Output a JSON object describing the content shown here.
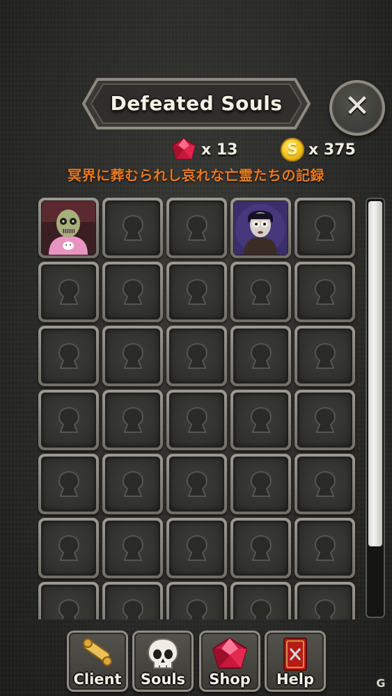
{
  "header": {
    "title": "Defeated Souls",
    "close_icon": "close-icon"
  },
  "currency": {
    "gems": {
      "icon": "ruby-gem-icon",
      "label": "x 13",
      "color": "#d8204a"
    },
    "coins": {
      "icon": "gold-coin-icon",
      "symbol": "S",
      "label": "x 375",
      "color": "#f2c21c"
    }
  },
  "subtitle": "冥界に葬むられし哀れな亡霊たちの記録",
  "grid": {
    "columns": 5,
    "slots": [
      {
        "state": "unlocked",
        "icon": "zombie-portrait-icon"
      },
      {
        "state": "locked"
      },
      {
        "state": "locked"
      },
      {
        "state": "unlocked",
        "icon": "ghost-boy-portrait-icon"
      },
      {
        "state": "locked"
      },
      {
        "state": "locked"
      },
      {
        "state": "locked"
      },
      {
        "state": "locked"
      },
      {
        "state": "locked"
      },
      {
        "state": "locked"
      },
      {
        "state": "locked"
      },
      {
        "state": "locked"
      },
      {
        "state": "locked"
      },
      {
        "state": "locked"
      },
      {
        "state": "locked"
      },
      {
        "state": "locked"
      },
      {
        "state": "locked"
      },
      {
        "state": "locked"
      },
      {
        "state": "locked"
      },
      {
        "state": "locked"
      },
      {
        "state": "locked"
      },
      {
        "state": "locked"
      },
      {
        "state": "locked"
      },
      {
        "state": "locked"
      },
      {
        "state": "locked"
      },
      {
        "state": "locked"
      },
      {
        "state": "locked"
      },
      {
        "state": "locked"
      },
      {
        "state": "locked"
      },
      {
        "state": "locked"
      },
      {
        "state": "locked"
      },
      {
        "state": "locked"
      },
      {
        "state": "locked"
      },
      {
        "state": "locked"
      },
      {
        "state": "locked"
      }
    ]
  },
  "nav": {
    "client": {
      "label": "Client",
      "icon": "scroll-icon"
    },
    "souls": {
      "label": "Souls",
      "icon": "skull-icon"
    },
    "shop": {
      "label": "Shop",
      "icon": "ruby-gem-icon"
    },
    "help": {
      "label": "Help",
      "icon": "help-card-icon"
    }
  },
  "colors": {
    "subtitle": "#e77a24",
    "background": "#2a2a28"
  }
}
